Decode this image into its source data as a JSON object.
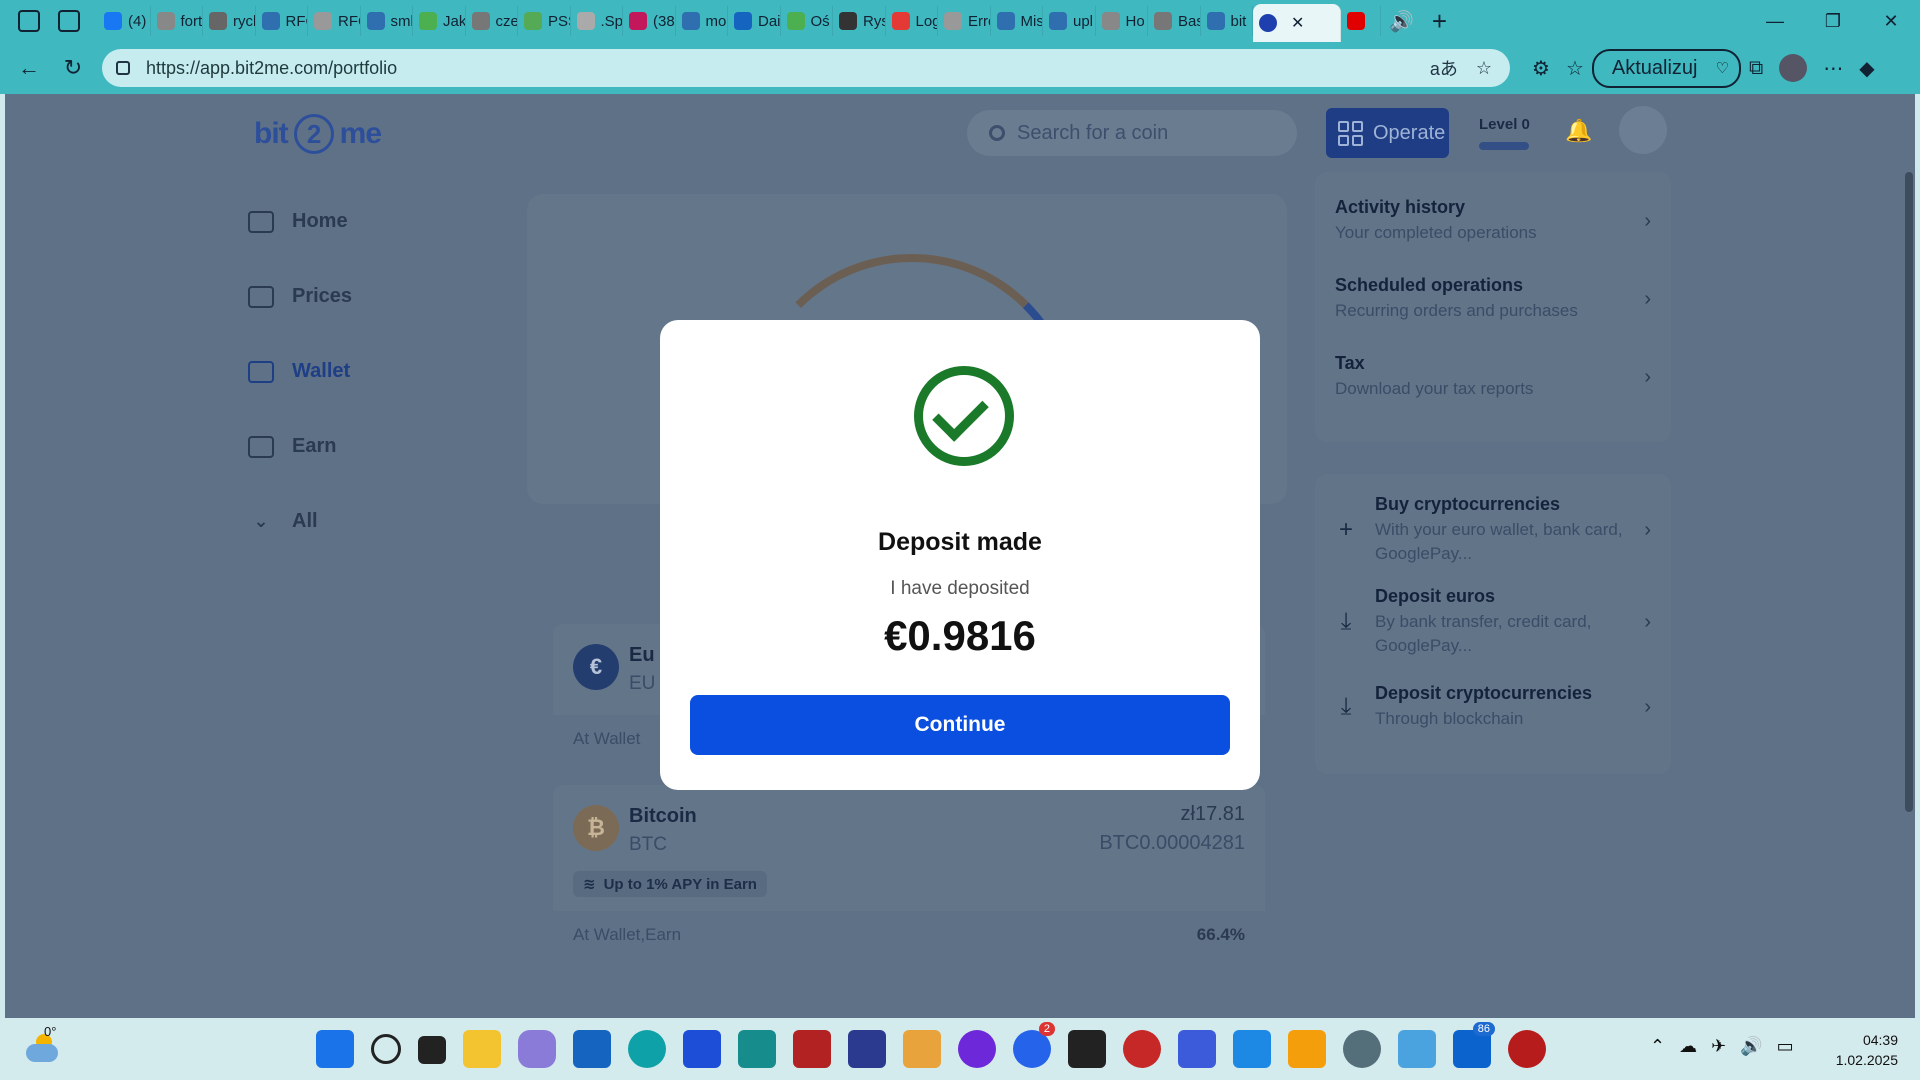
{
  "browser": {
    "tabs": [
      {
        "label": "(4)",
        "color": "#1877f2"
      },
      {
        "label": "fort",
        "color": "#888888"
      },
      {
        "label": "rycl",
        "color": "#666666"
      },
      {
        "label": "RFC",
        "color": "#2f6fb0"
      },
      {
        "label": "RFC",
        "color": "#999999"
      },
      {
        "label": "sml",
        "color": "#2f6fb0"
      },
      {
        "label": "Jak",
        "color": "#4caf50"
      },
      {
        "label": "cze",
        "color": "#777777"
      },
      {
        "label": "PSS",
        "color": "#55aa55"
      },
      {
        "label": ".Sp",
        "color": "#aaaaaa"
      },
      {
        "label": "(38",
        "color": "#c2185b"
      },
      {
        "label": "mo",
        "color": "#2f6fb0"
      },
      {
        "label": "Dai",
        "color": "#1565c0"
      },
      {
        "label": "Oś",
        "color": "#4caf50"
      },
      {
        "label": "Rys",
        "color": "#333333"
      },
      {
        "label": "Log",
        "color": "#e53935"
      },
      {
        "label": "Erro",
        "color": "#999999"
      },
      {
        "label": "Mis",
        "color": "#2f6fb0"
      },
      {
        "label": "upl",
        "color": "#2f6fb0"
      },
      {
        "label": "Ho",
        "color": "#888888"
      },
      {
        "label": "Bas",
        "color": "#777777"
      },
      {
        "label": "bit",
        "color": "#2f6fb0"
      }
    ],
    "active_tab_label": "",
    "url": "https://app.bit2me.com/portfolio",
    "update_label": "Aktualizuj"
  },
  "header": {
    "logo_left": "bit",
    "logo_mid": "2",
    "logo_right": "me",
    "search_placeholder": "Search for a coin",
    "operate_label": "Operate",
    "level_label": "Level 0"
  },
  "sidebar": {
    "items": [
      {
        "label": "Home",
        "icon": "home-icon"
      },
      {
        "label": "Prices",
        "icon": "trend-icon"
      },
      {
        "label": "Wallet",
        "icon": "wallet-icon"
      },
      {
        "label": "Earn",
        "icon": "earn-icon"
      },
      {
        "label": "All",
        "icon": "chevron-down-icon"
      }
    ]
  },
  "right_panel": {
    "top": [
      {
        "title": "Activity history",
        "subtitle": "Your completed operations"
      },
      {
        "title": "Scheduled operations",
        "subtitle": "Recurring orders and purchases"
      },
      {
        "title": "Tax",
        "subtitle": "Download your tax reports"
      }
    ],
    "actions": [
      {
        "title": "Buy cryptocurrencies",
        "subtitle": "With your euro wallet, bank card, GooglePay...",
        "icon": "plus-icon"
      },
      {
        "title": "Deposit euros",
        "subtitle": "By bank transfer, credit card, GooglePay...",
        "icon": "download-icon"
      },
      {
        "title": "Deposit cryptocurrencies",
        "subtitle": "Through blockchain",
        "icon": "download-icon"
      }
    ]
  },
  "assets": {
    "euro": {
      "name": "Eu",
      "symbol": "EU",
      "coin": "€",
      "foot_left": "At Wallet"
    },
    "bitcoin": {
      "name": "Bitcoin",
      "symbol": "BTC",
      "coin": "₿",
      "value_pln": "zł17.81",
      "value_btc": "BTC0.00004281",
      "badge": "Up to 1% APY in Earn",
      "foot_left": "At Wallet,Earn",
      "foot_right": "66.4%"
    }
  },
  "modal": {
    "title": "Deposit made",
    "subtitle": "I have deposited",
    "amount": "€0.9816",
    "button": "Continue"
  },
  "taskbar": {
    "temperature": "0°",
    "badge_outlook": "2",
    "badge_mail": "86",
    "time": "04:39",
    "date": "1.02.2025"
  }
}
